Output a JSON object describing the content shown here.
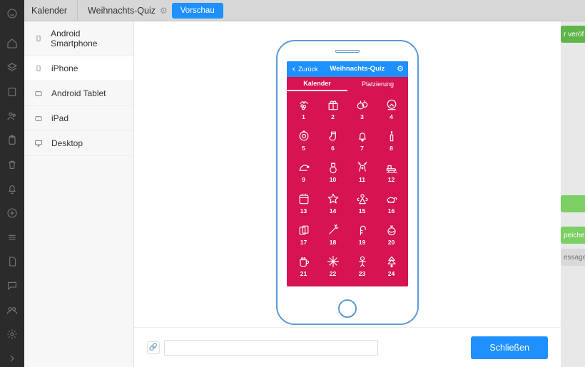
{
  "header": {
    "section": "Kalender",
    "title": "Weihnachts-Quiz",
    "preview_label": "Vorschau"
  },
  "devices": {
    "items": [
      {
        "label": "Android Smartphone",
        "icon": "smartphone",
        "active": false
      },
      {
        "label": "iPhone",
        "icon": "smartphone",
        "active": true
      },
      {
        "label": "Android Tablet",
        "icon": "tablet-land",
        "active": false
      },
      {
        "label": "iPad",
        "icon": "tablet-land",
        "active": false
      },
      {
        "label": "Desktop",
        "icon": "desktop",
        "active": false
      }
    ]
  },
  "footer": {
    "link_value": "",
    "close_label": "Schließen"
  },
  "right_chips": {
    "green1": "r veröf",
    "green2": "",
    "green3": "peiche",
    "grey": "essage"
  },
  "phone": {
    "nav": {
      "back_label": "Zurück",
      "title": "Weihnachts-Quiz"
    },
    "tabs": {
      "calendar": "Kalender",
      "ranking": "Platzierung"
    },
    "calendar": {
      "days": [
        {
          "n": "1",
          "icon": "holly"
        },
        {
          "n": "2",
          "icon": "gift"
        },
        {
          "n": "3",
          "icon": "bauble"
        },
        {
          "n": "4",
          "icon": "snowglobe"
        },
        {
          "n": "5",
          "icon": "wreath"
        },
        {
          "n": "6",
          "icon": "stocking"
        },
        {
          "n": "7",
          "icon": "bell"
        },
        {
          "n": "8",
          "icon": "candle"
        },
        {
          "n": "9",
          "icon": "santa-hat"
        },
        {
          "n": "10",
          "icon": "snowman"
        },
        {
          "n": "11",
          "icon": "reindeer"
        },
        {
          "n": "12",
          "icon": "sleigh"
        },
        {
          "n": "13",
          "icon": "calendar"
        },
        {
          "n": "14",
          "icon": "star"
        },
        {
          "n": "15",
          "icon": "angel"
        },
        {
          "n": "16",
          "icon": "turkey"
        },
        {
          "n": "17",
          "icon": "cards"
        },
        {
          "n": "18",
          "icon": "sparkler"
        },
        {
          "n": "19",
          "icon": "candycane"
        },
        {
          "n": "20",
          "icon": "bauble2"
        },
        {
          "n": "21",
          "icon": "mug"
        },
        {
          "n": "22",
          "icon": "snowflake"
        },
        {
          "n": "23",
          "icon": "gingerman"
        },
        {
          "n": "24",
          "icon": "tree"
        }
      ]
    }
  },
  "colors": {
    "accent_blue": "#1e90ff",
    "phone_outline": "#5a9ad6",
    "calendar_bg": "#d51451"
  }
}
